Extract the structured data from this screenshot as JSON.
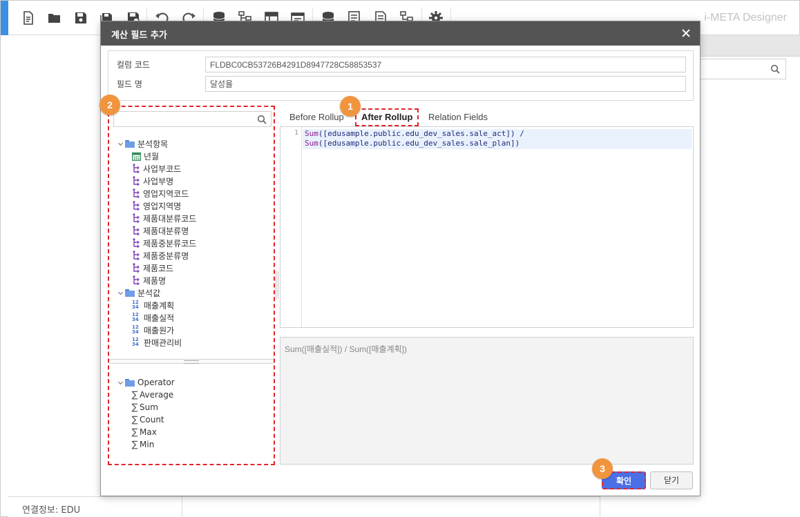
{
  "app": {
    "title": "i-META Designer",
    "status_text": "연결정보: EDU"
  },
  "toolbar_icons": [
    "new-file-icon",
    "open-folder-icon",
    "save-icon",
    "save-as-icon",
    "save-all-icon",
    "undo-icon",
    "redo-icon",
    "database-icon",
    "hierarchy-icon",
    "table-icon",
    "sheet-icon",
    "database-2-icon",
    "report-icon",
    "document-icon",
    "hierarchy-2-icon",
    "settings-gear-icon"
  ],
  "modal": {
    "title": "계산 필드 추가",
    "column_code_label": "컬럼 코드",
    "column_code_value": "FLDBC0CB53726B4291D8947728C58853537",
    "field_name_label": "필드 명",
    "field_name_value": "달성율"
  },
  "tree": {
    "analysis_items": {
      "label": "분석항목",
      "children": [
        {
          "label": "년월",
          "icon": "calendar-icon"
        },
        {
          "label": "사업부코드",
          "icon": "hierarchy-icon"
        },
        {
          "label": "사업부명",
          "icon": "hierarchy-icon"
        },
        {
          "label": "영업지역코드",
          "icon": "hierarchy-icon"
        },
        {
          "label": "영업지역명",
          "icon": "hierarchy-icon"
        },
        {
          "label": "제품대분류코드",
          "icon": "hierarchy-icon"
        },
        {
          "label": "제품대분류명",
          "icon": "hierarchy-icon"
        },
        {
          "label": "제품중분류코드",
          "icon": "hierarchy-icon"
        },
        {
          "label": "제품중분류명",
          "icon": "hierarchy-icon"
        },
        {
          "label": "제품코드",
          "icon": "hierarchy-icon"
        },
        {
          "label": "제품명",
          "icon": "hierarchy-icon"
        }
      ]
    },
    "analysis_values": {
      "label": "분석값",
      "children": [
        {
          "label": "매출계획",
          "icon": "numeric-icon"
        },
        {
          "label": "매출실적",
          "icon": "numeric-icon"
        },
        {
          "label": "매출원가",
          "icon": "numeric-icon"
        },
        {
          "label": "판매관리비",
          "icon": "numeric-icon"
        }
      ]
    },
    "operator": {
      "label": "Operator",
      "children": [
        "Average",
        "Sum",
        "Count",
        "Max",
        "Min"
      ]
    },
    "numeric_icon_text": [
      "12",
      "34"
    ],
    "sigma_symbol": "∑"
  },
  "tabs": [
    {
      "label": "Before Rollup",
      "active": false
    },
    {
      "label": "After Rollup",
      "active": true
    },
    {
      "label": "Relation Fields",
      "active": false
    }
  ],
  "editor": {
    "line_number": "1",
    "lines": [
      {
        "func": "Sum",
        "rest": "([edusample.public.edu_dev_sales.sale_act]) /"
      },
      {
        "func": "Sum",
        "rest": "([edusample.public.edu_dev_sales.sale_plan])"
      }
    ]
  },
  "preview_text": "Sum([매출실적]) / Sum([매출계획])",
  "buttons": {
    "ok": "확인",
    "close": "닫기"
  },
  "callouts": [
    "1",
    "2",
    "3"
  ],
  "colors": {
    "accent_blue": "#3c8fe6",
    "modal_header": "#545454",
    "highlight_dashed": "#e0252b",
    "callout_orange": "#f0953e",
    "ok_button": "#4a6fe6"
  }
}
